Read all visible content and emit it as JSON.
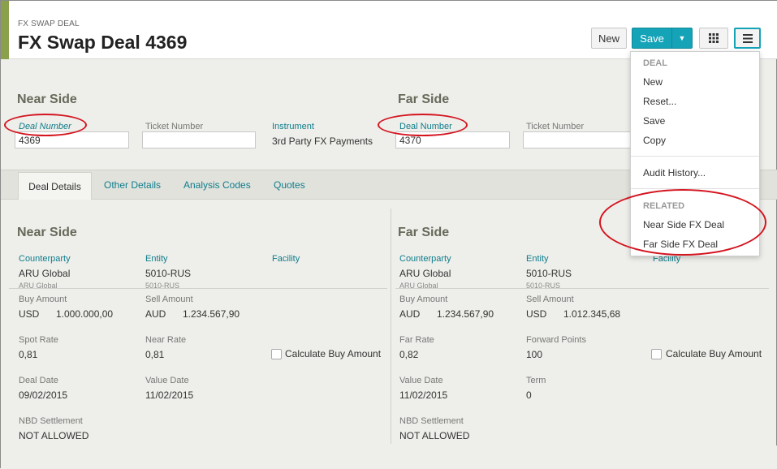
{
  "header": {
    "breadcrumb": "FX SWAP DEAL",
    "title": "FX Swap Deal 4369",
    "new_label": "New",
    "save_label": "Save"
  },
  "top": {
    "near": {
      "title": "Near Side",
      "deal_number_label": "Deal Number",
      "deal_number": "4369",
      "ticket_label": "Ticket Number",
      "ticket": "",
      "instrument_label": "Instrument",
      "instrument": "3rd Party FX Payments"
    },
    "far": {
      "title": "Far Side",
      "deal_number_label": "Deal Number",
      "deal_number": "4370",
      "ticket_label": "Ticket Number",
      "ticket": ""
    }
  },
  "tabs": [
    "Deal Details",
    "Other Details",
    "Analysis Codes",
    "Quotes"
  ],
  "details": {
    "near": {
      "title": "Near Side",
      "counterparty_label": "Counterparty",
      "counterparty": "ARU Global",
      "counterparty_sub": "ARU Global",
      "entity_label": "Entity",
      "entity": "5010-RUS",
      "entity_sub": "5010-RUS",
      "facility_label": "Facility",
      "buy_amount_label": "Buy Amount",
      "buy_ccy": "USD",
      "buy_amount": "1.000.000,00",
      "sell_amount_label": "Sell Amount",
      "sell_ccy": "AUD",
      "sell_amount": "1.234.567,90",
      "spot_rate_label": "Spot Rate",
      "spot_rate": "0,81",
      "near_rate_label": "Near Rate",
      "near_rate": "0,81",
      "calc_label": "Calculate Buy Amount",
      "deal_date_label": "Deal Date",
      "deal_date": "09/02/2015",
      "value_date_label": "Value Date",
      "value_date": "11/02/2015",
      "nbd_label": "NBD Settlement",
      "nbd": "NOT ALLOWED"
    },
    "far": {
      "title": "Far Side",
      "counterparty_label": "Counterparty",
      "counterparty": "ARU Global",
      "counterparty_sub": "ARU Global",
      "entity_label": "Entity",
      "entity": "5010-RUS",
      "entity_sub": "5010-RUS",
      "facility_label": "Facility",
      "buy_amount_label": "Buy Amount",
      "buy_ccy": "AUD",
      "buy_amount": "1.234.567,90",
      "sell_amount_label": "Sell Amount",
      "sell_ccy": "USD",
      "sell_amount": "1.012.345,68",
      "far_rate_label": "Far Rate",
      "far_rate": "0,82",
      "fwd_points_label": "Forward Points",
      "fwd_points": "100",
      "calc_label": "Calculate Buy Amount",
      "value_date_label": "Value Date",
      "value_date": "11/02/2015",
      "term_label": "Term",
      "term": "0",
      "nbd_label": "NBD Settlement",
      "nbd": "NOT ALLOWED"
    }
  },
  "menu": {
    "deal_header": "DEAL",
    "items": [
      "New",
      "Reset...",
      "Save",
      "Copy"
    ],
    "audit": "Audit History...",
    "related_header": "RELATED",
    "related": [
      "Near Side FX Deal",
      "Far Side FX Deal"
    ]
  },
  "colors": {
    "accent": "#8aa04a",
    "primary": "#15a3b8",
    "link": "#0e7d8c",
    "annotation": "#d4141f"
  }
}
